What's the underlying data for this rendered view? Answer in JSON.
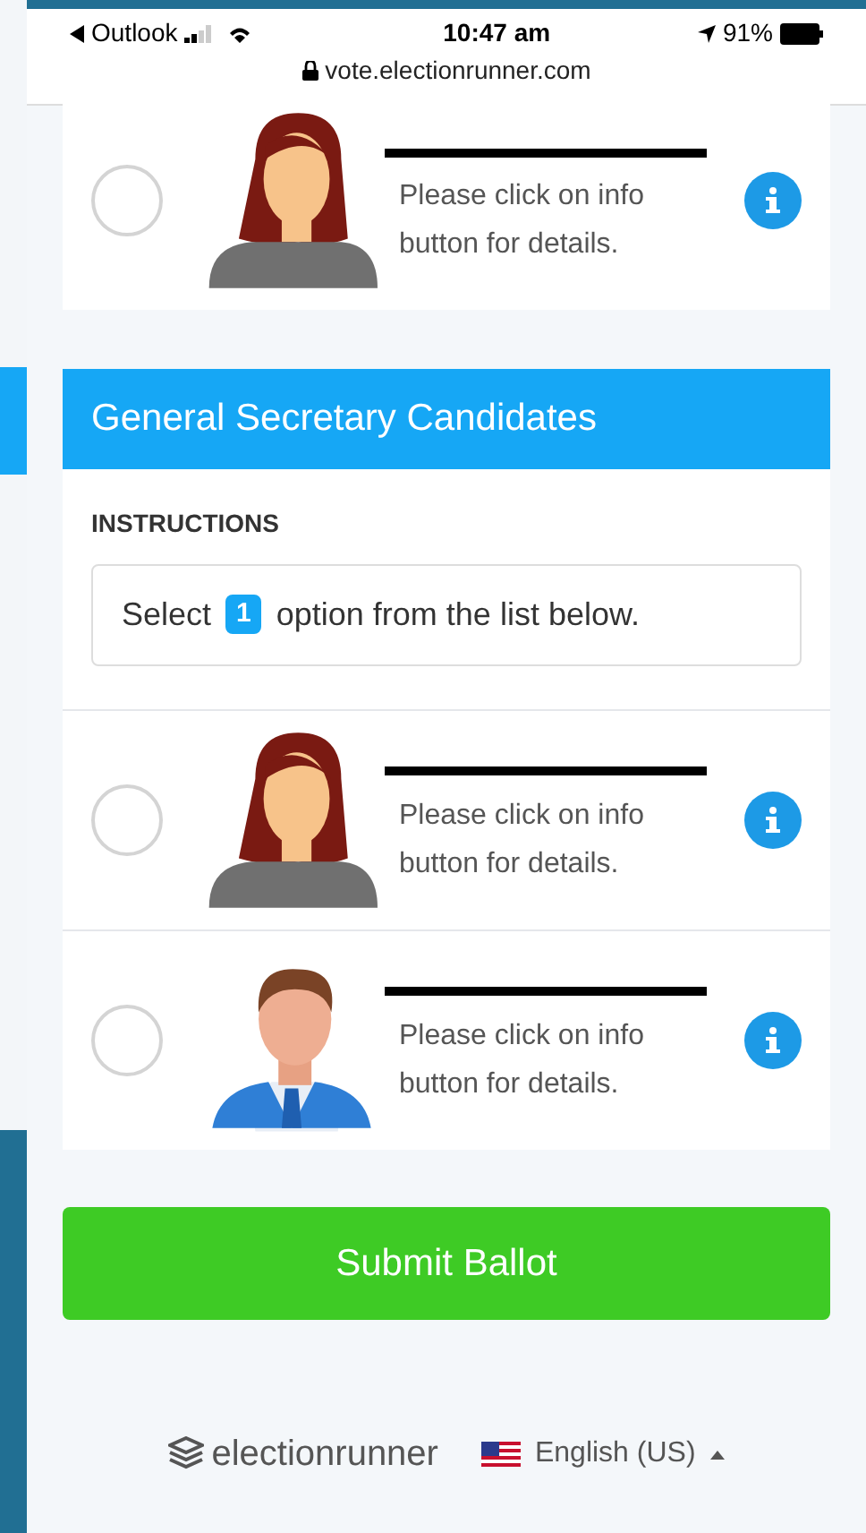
{
  "status_bar": {
    "back_app": "Outlook",
    "time": "10:47 am",
    "battery": "91%"
  },
  "address_bar": {
    "url": "vote.electionrunner.com"
  },
  "top_candidates": [
    {
      "redacted": true,
      "description": "Please click on info button for details.",
      "kind": "female",
      "selected": false
    }
  ],
  "section": {
    "title": "General Secretary Candidates",
    "instructions_label": "INSTRUCTIONS",
    "instruction_before": "Select",
    "count": "1",
    "instruction_after": "option from the list below.",
    "candidates": [
      {
        "redacted": true,
        "description": "Please click on info button for details.",
        "kind": "female",
        "selected": false
      },
      {
        "redacted": true,
        "description": "Please click on info button for details.",
        "kind": "male",
        "selected": false
      }
    ]
  },
  "submit_button": "Submit Ballot",
  "footer": {
    "brand": "electionrunner",
    "language": "English (US)"
  }
}
